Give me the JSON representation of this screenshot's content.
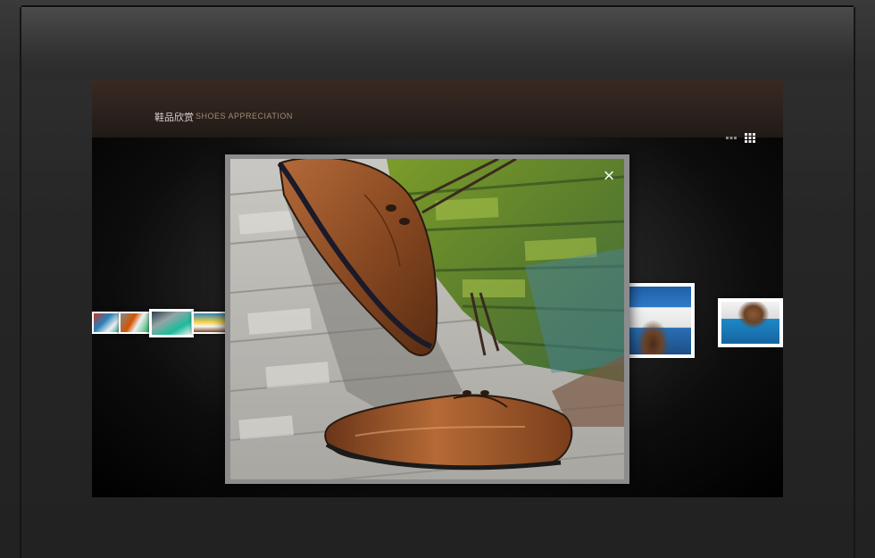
{
  "header": {
    "title_cn": "鞋品欣赏",
    "title_en": "SHOES APPRECIATION"
  },
  "toolbar": {
    "list_view_icon": "list-view-icon",
    "grid_view_icon": "grid-view-icon"
  },
  "lightbox": {
    "close_label": "×",
    "close_icon": "close-icon"
  },
  "colors": {
    "header_bg": "#2c221d",
    "title_en": "#9e8c74",
    "shoe_leather": "#8a4a22"
  }
}
